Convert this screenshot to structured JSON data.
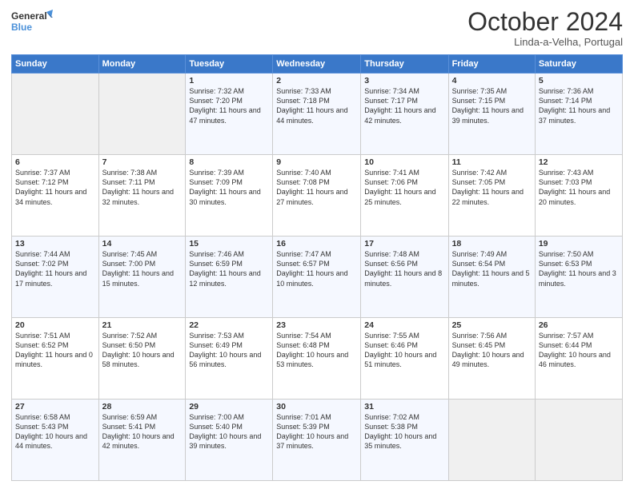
{
  "header": {
    "logo_line1": "General",
    "logo_line2": "Blue",
    "month": "October 2024",
    "location": "Linda-a-Velha, Portugal"
  },
  "weekdays": [
    "Sunday",
    "Monday",
    "Tuesday",
    "Wednesday",
    "Thursday",
    "Friday",
    "Saturday"
  ],
  "weeks": [
    [
      {
        "day": "",
        "sunrise": "",
        "sunset": "",
        "daylight": ""
      },
      {
        "day": "",
        "sunrise": "",
        "sunset": "",
        "daylight": ""
      },
      {
        "day": "1",
        "sunrise": "Sunrise: 7:32 AM",
        "sunset": "Sunset: 7:20 PM",
        "daylight": "Daylight: 11 hours and 47 minutes."
      },
      {
        "day": "2",
        "sunrise": "Sunrise: 7:33 AM",
        "sunset": "Sunset: 7:18 PM",
        "daylight": "Daylight: 11 hours and 44 minutes."
      },
      {
        "day": "3",
        "sunrise": "Sunrise: 7:34 AM",
        "sunset": "Sunset: 7:17 PM",
        "daylight": "Daylight: 11 hours and 42 minutes."
      },
      {
        "day": "4",
        "sunrise": "Sunrise: 7:35 AM",
        "sunset": "Sunset: 7:15 PM",
        "daylight": "Daylight: 11 hours and 39 minutes."
      },
      {
        "day": "5",
        "sunrise": "Sunrise: 7:36 AM",
        "sunset": "Sunset: 7:14 PM",
        "daylight": "Daylight: 11 hours and 37 minutes."
      }
    ],
    [
      {
        "day": "6",
        "sunrise": "Sunrise: 7:37 AM",
        "sunset": "Sunset: 7:12 PM",
        "daylight": "Daylight: 11 hours and 34 minutes."
      },
      {
        "day": "7",
        "sunrise": "Sunrise: 7:38 AM",
        "sunset": "Sunset: 7:11 PM",
        "daylight": "Daylight: 11 hours and 32 minutes."
      },
      {
        "day": "8",
        "sunrise": "Sunrise: 7:39 AM",
        "sunset": "Sunset: 7:09 PM",
        "daylight": "Daylight: 11 hours and 30 minutes."
      },
      {
        "day": "9",
        "sunrise": "Sunrise: 7:40 AM",
        "sunset": "Sunset: 7:08 PM",
        "daylight": "Daylight: 11 hours and 27 minutes."
      },
      {
        "day": "10",
        "sunrise": "Sunrise: 7:41 AM",
        "sunset": "Sunset: 7:06 PM",
        "daylight": "Daylight: 11 hours and 25 minutes."
      },
      {
        "day": "11",
        "sunrise": "Sunrise: 7:42 AM",
        "sunset": "Sunset: 7:05 PM",
        "daylight": "Daylight: 11 hours and 22 minutes."
      },
      {
        "day": "12",
        "sunrise": "Sunrise: 7:43 AM",
        "sunset": "Sunset: 7:03 PM",
        "daylight": "Daylight: 11 hours and 20 minutes."
      }
    ],
    [
      {
        "day": "13",
        "sunrise": "Sunrise: 7:44 AM",
        "sunset": "Sunset: 7:02 PM",
        "daylight": "Daylight: 11 hours and 17 minutes."
      },
      {
        "day": "14",
        "sunrise": "Sunrise: 7:45 AM",
        "sunset": "Sunset: 7:00 PM",
        "daylight": "Daylight: 11 hours and 15 minutes."
      },
      {
        "day": "15",
        "sunrise": "Sunrise: 7:46 AM",
        "sunset": "Sunset: 6:59 PM",
        "daylight": "Daylight: 11 hours and 12 minutes."
      },
      {
        "day": "16",
        "sunrise": "Sunrise: 7:47 AM",
        "sunset": "Sunset: 6:57 PM",
        "daylight": "Daylight: 11 hours and 10 minutes."
      },
      {
        "day": "17",
        "sunrise": "Sunrise: 7:48 AM",
        "sunset": "Sunset: 6:56 PM",
        "daylight": "Daylight: 11 hours and 8 minutes."
      },
      {
        "day": "18",
        "sunrise": "Sunrise: 7:49 AM",
        "sunset": "Sunset: 6:54 PM",
        "daylight": "Daylight: 11 hours and 5 minutes."
      },
      {
        "day": "19",
        "sunrise": "Sunrise: 7:50 AM",
        "sunset": "Sunset: 6:53 PM",
        "daylight": "Daylight: 11 hours and 3 minutes."
      }
    ],
    [
      {
        "day": "20",
        "sunrise": "Sunrise: 7:51 AM",
        "sunset": "Sunset: 6:52 PM",
        "daylight": "Daylight: 11 hours and 0 minutes."
      },
      {
        "day": "21",
        "sunrise": "Sunrise: 7:52 AM",
        "sunset": "Sunset: 6:50 PM",
        "daylight": "Daylight: 10 hours and 58 minutes."
      },
      {
        "day": "22",
        "sunrise": "Sunrise: 7:53 AM",
        "sunset": "Sunset: 6:49 PM",
        "daylight": "Daylight: 10 hours and 56 minutes."
      },
      {
        "day": "23",
        "sunrise": "Sunrise: 7:54 AM",
        "sunset": "Sunset: 6:48 PM",
        "daylight": "Daylight: 10 hours and 53 minutes."
      },
      {
        "day": "24",
        "sunrise": "Sunrise: 7:55 AM",
        "sunset": "Sunset: 6:46 PM",
        "daylight": "Daylight: 10 hours and 51 minutes."
      },
      {
        "day": "25",
        "sunrise": "Sunrise: 7:56 AM",
        "sunset": "Sunset: 6:45 PM",
        "daylight": "Daylight: 10 hours and 49 minutes."
      },
      {
        "day": "26",
        "sunrise": "Sunrise: 7:57 AM",
        "sunset": "Sunset: 6:44 PM",
        "daylight": "Daylight: 10 hours and 46 minutes."
      }
    ],
    [
      {
        "day": "27",
        "sunrise": "Sunrise: 6:58 AM",
        "sunset": "Sunset: 5:43 PM",
        "daylight": "Daylight: 10 hours and 44 minutes."
      },
      {
        "day": "28",
        "sunrise": "Sunrise: 6:59 AM",
        "sunset": "Sunset: 5:41 PM",
        "daylight": "Daylight: 10 hours and 42 minutes."
      },
      {
        "day": "29",
        "sunrise": "Sunrise: 7:00 AM",
        "sunset": "Sunset: 5:40 PM",
        "daylight": "Daylight: 10 hours and 39 minutes."
      },
      {
        "day": "30",
        "sunrise": "Sunrise: 7:01 AM",
        "sunset": "Sunset: 5:39 PM",
        "daylight": "Daylight: 10 hours and 37 minutes."
      },
      {
        "day": "31",
        "sunrise": "Sunrise: 7:02 AM",
        "sunset": "Sunset: 5:38 PM",
        "daylight": "Daylight: 10 hours and 35 minutes."
      },
      {
        "day": "",
        "sunrise": "",
        "sunset": "",
        "daylight": ""
      },
      {
        "day": "",
        "sunrise": "",
        "sunset": "",
        "daylight": ""
      }
    ]
  ]
}
